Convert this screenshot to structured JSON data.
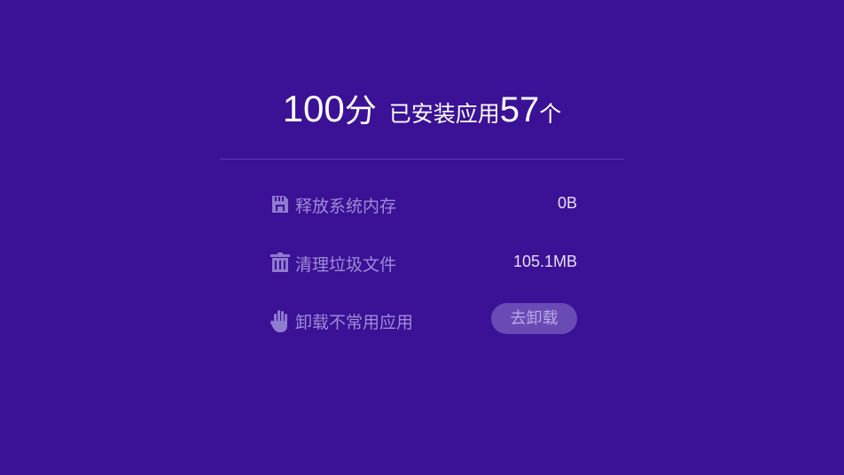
{
  "summary": {
    "score_value": "100",
    "score_unit": "分",
    "installed_label": "已安装应用",
    "installed_count": "57",
    "installed_unit": "个"
  },
  "items": [
    {
      "label": "释放系统内存",
      "value": "0B",
      "icon": "memory-card-icon"
    },
    {
      "label": "清理垃圾文件",
      "value": "105.1MB",
      "icon": "trash-icon"
    },
    {
      "label": "卸载不常用应用",
      "button_label": "去卸载",
      "icon": "hand-icon"
    }
  ],
  "colors": {
    "background": "#3b1196",
    "label_text": "#9e8cd6",
    "value_text": "#e6e0f7",
    "button_bg": "#6a4ab5",
    "icon": "#8f7bd0"
  }
}
